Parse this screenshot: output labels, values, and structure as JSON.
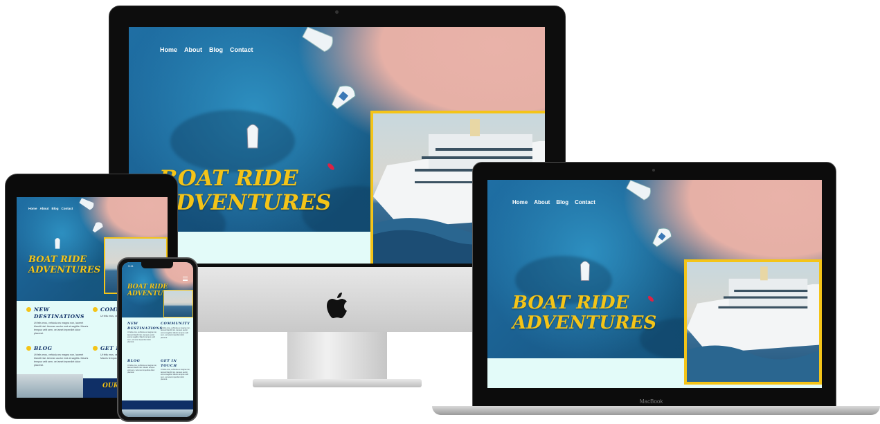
{
  "site": {
    "nav": [
      "Home",
      "About",
      "Blog",
      "Contact"
    ],
    "hero_line1": "BOAT RIDE",
    "hero_line2": "ADVENTURES",
    "accent": "#f4c418",
    "navy": "#0f2f66",
    "strip": "#e3fbf9"
  },
  "imac": {
    "hero_line1": "BOAT RIDE",
    "hero_line2": "ADVENTURES"
  },
  "macbook": {
    "brand": "MacBook"
  },
  "tablet": {
    "sections": [
      {
        "title_line1": "NEW",
        "title_line2": "DESTINATIONS",
        "text": "Ut felis eros, vehicula eu magna non, laoreet blandit nisi. Aenean auctor erat at sagittis. Mauris tempus velit sem, vel amet imperdiet dolor placerat."
      },
      {
        "title_line1": "COMMUNITY",
        "title_line2": "",
        "text": "Ut felis eros, vehicula eu magna non, laoreet blandit nisi."
      },
      {
        "title_line1": "BLOG",
        "title_line2": "",
        "text": "Ut felis eros, vehicula eu magna non, laoreet blandit nisi. Aenean auctor erat at sagittis. Mauris tempus velit sem, vel amet imperdiet dolor placerat."
      },
      {
        "title_line1": "GET IN",
        "title_line2": "",
        "text": "Ut felis eros, vehicula eu magna non, laoreet blandit nisi. Mauris tempus velit sem."
      }
    ],
    "footer_text": "OUR"
  },
  "phone": {
    "time": "9:41",
    "hero_line1": "BOAT RIDE",
    "hero_line2": "ADVENTURES",
    "sections": [
      {
        "title_line1": "NEW",
        "title_line2": "DESTINATIONS",
        "text": "Ut felis eros, vehicula eu magna non, laoreet blandit nisi. Aenean auctor erat at sagittis. Mauris tempus velit sem, vel amet imperdiet dolor placerat."
      },
      {
        "title_line1": "COMMUNITY",
        "title_line2": "",
        "text": "Ut felis eros, vehicula eu magna non, laoreet blandit nisi. Aenean auctor erat at sagittis. Mauris tempus velit sem, vel amet imperdiet dolor placerat."
      },
      {
        "title_line1": "BLOG",
        "title_line2": "",
        "text": "Ut felis eros, vehicula eu magna non, laoreet blandit nisi. Mauris tempus velit sem, vel amet imperdiet dolor placerat."
      },
      {
        "title_line1": "GET IN",
        "title_line2": "TOUCH",
        "text": "Ut felis eros, vehicula eu magna non, laoreet blandit nisi. Aenean auctor erat at sagittis. Mauris tempus velit sem, vel amet imperdiet dolor placerat."
      }
    ]
  },
  "icons": [
    "apple-logo-icon",
    "hamburger-menu-icon",
    "camera-icon"
  ]
}
